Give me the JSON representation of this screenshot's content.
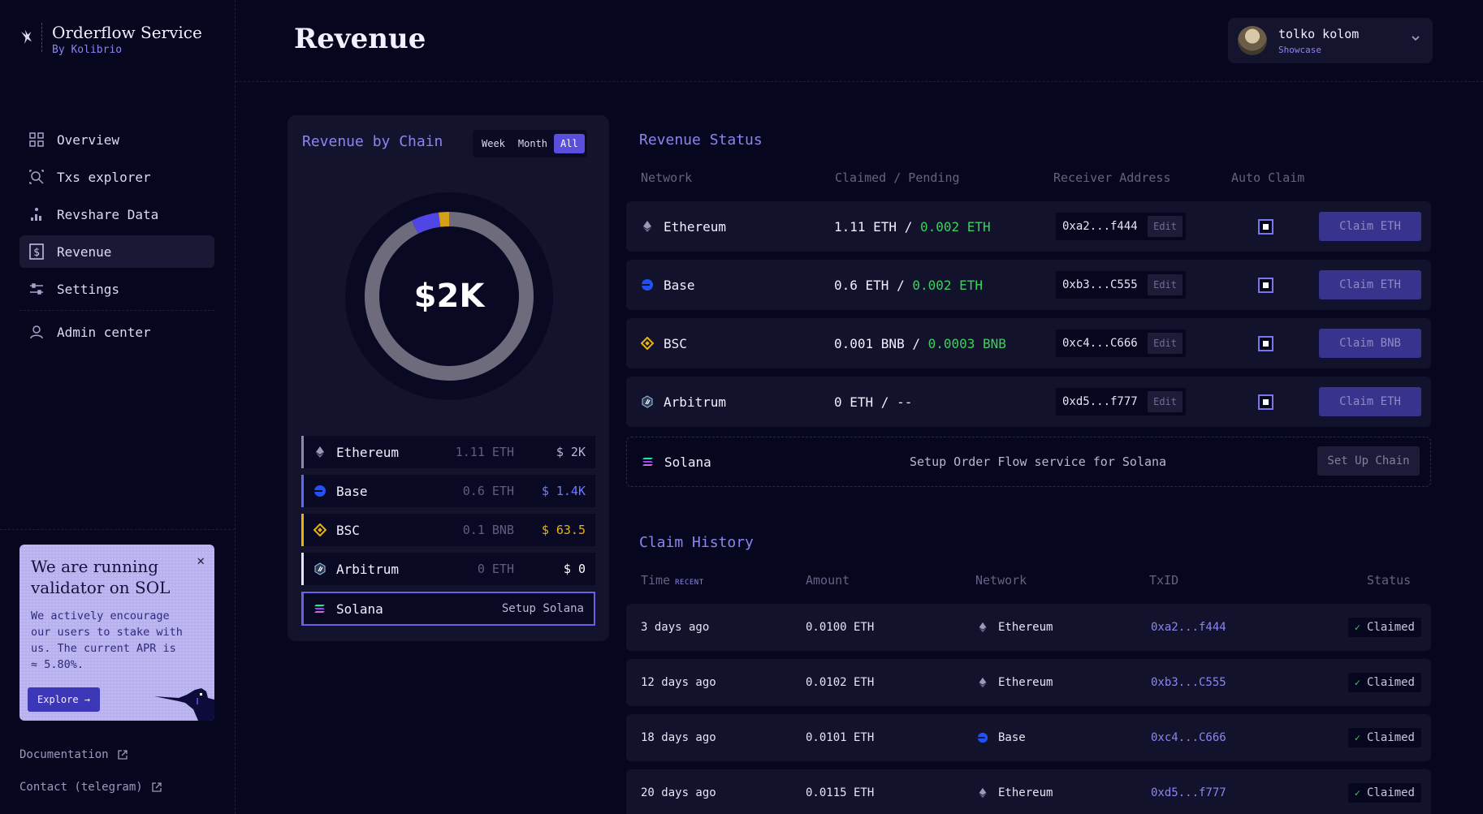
{
  "brand": {
    "title": "Orderflow Service",
    "subtitle": "By Kolibrio"
  },
  "nav": [
    {
      "label": "Overview",
      "icon": "grid-icon",
      "active": false
    },
    {
      "label": "Txs explorer",
      "icon": "magnifier-icon",
      "active": false
    },
    {
      "label": "Revshare Data",
      "icon": "chart-icon",
      "active": false
    },
    {
      "label": "Revenue",
      "icon": "dollar-icon",
      "active": true
    },
    {
      "label": "Settings",
      "icon": "sliders-icon",
      "active": false
    },
    {
      "label": "Admin center",
      "icon": "user-icon",
      "active": false
    }
  ],
  "promo": {
    "title": "We are running validator on SOL",
    "text": "We actively encourage our users to stake with us. The current APR is ≈ 5.80%.",
    "button": "Explore →"
  },
  "links": {
    "documentation": "Documentation",
    "contact": "Contact (telegram)"
  },
  "header": {
    "title": "Revenue"
  },
  "user": {
    "name": "tolko kolom",
    "role": "Showcase"
  },
  "chain_card": {
    "title": "Revenue by Chain",
    "periods": [
      "Week",
      "Month",
      "All"
    ],
    "selected_period": "All",
    "total": "$2K",
    "chart_data": {
      "type": "pie",
      "categories": [
        "Ethereum",
        "Base",
        "BSC",
        "Arbitrum"
      ],
      "values": [
        1.4,
        0.08,
        0.03,
        0
      ],
      "colors": [
        "#6e6b7d",
        "#4f46e5",
        "#d4a017",
        "#c9c7e0"
      ]
    },
    "rows": [
      {
        "name": "Ethereum",
        "amount": "1.11 ETH",
        "usd": "$ 2K",
        "color": "#8a89a8",
        "usd_color": "#b8b6d3"
      },
      {
        "name": "Base",
        "amount": "0.6 ETH",
        "usd": "$ 1.4K",
        "color": "#5b6cf0",
        "usd_color": "#6c7cff"
      },
      {
        "name": "BSC",
        "amount": "0.1 BNB",
        "usd": "$ 63.5",
        "color": "#e8b30e",
        "usd_color": "#e8b30e"
      },
      {
        "name": "Arbitrum",
        "amount": "0 ETH",
        "usd": "$ 0",
        "color": "#e6e4f5",
        "usd_color": "#ffffff"
      },
      {
        "name": "Solana",
        "amount": "",
        "usd": "Setup Solana",
        "color": "#6b5fe6",
        "usd_color": "#b8b6d3"
      }
    ]
  },
  "status": {
    "title": "Revenue Status",
    "columns": [
      "Network",
      "Claimed / Pending",
      "Receiver Address",
      "Auto Claim"
    ],
    "rows": [
      {
        "network": "Ethereum",
        "claimed": "1.11 ETH",
        "sep": " / ",
        "pending": "0.002 ETH",
        "address": "0xa2...f444",
        "edit": "Edit",
        "auto": true,
        "action": "Claim ETH"
      },
      {
        "network": "Base",
        "claimed": "0.6 ETH",
        "sep": " / ",
        "pending": "0.002 ETH",
        "address": "0xb3...C555",
        "edit": "Edit",
        "auto": true,
        "action": "Claim ETH"
      },
      {
        "network": "BSC",
        "claimed": "0.001 BNB",
        "sep": " / ",
        "pending": "0.0003 BNB",
        "address": "0xc4...C666",
        "edit": "Edit",
        "auto": true,
        "action": "Claim BNB"
      },
      {
        "network": "Arbitrum",
        "claimed": "0 ETH",
        "sep": " / --",
        "pending": "",
        "address": "0xd5...f777",
        "edit": "Edit",
        "auto": true,
        "action": "Claim ETH"
      }
    ],
    "solana": {
      "network": "Solana",
      "description": "Setup Order Flow service for Solana",
      "action": "Set Up Chain"
    }
  },
  "history": {
    "title": "Claim History",
    "columns": {
      "time": "Time",
      "recent": "RECENT",
      "amount": "Amount",
      "network": "Network",
      "txid": "TxID",
      "status": "Status"
    },
    "rows": [
      {
        "time": "3 days ago",
        "amount": "0.0100 ETH",
        "network": "Ethereum",
        "txid": "0xa2...f444",
        "status": "Claimed"
      },
      {
        "time": "12 days ago",
        "amount": "0.0102 ETH",
        "network": "Ethereum",
        "txid": "0xb3...C555",
        "status": "Claimed"
      },
      {
        "time": "18 days ago",
        "amount": "0.0101 ETH",
        "network": "Base",
        "txid": "0xc4...C666",
        "status": "Claimed"
      },
      {
        "time": "20 days ago",
        "amount": "0.0115 ETH",
        "network": "Ethereum",
        "txid": "0xd5...f777",
        "status": "Claimed"
      }
    ]
  }
}
